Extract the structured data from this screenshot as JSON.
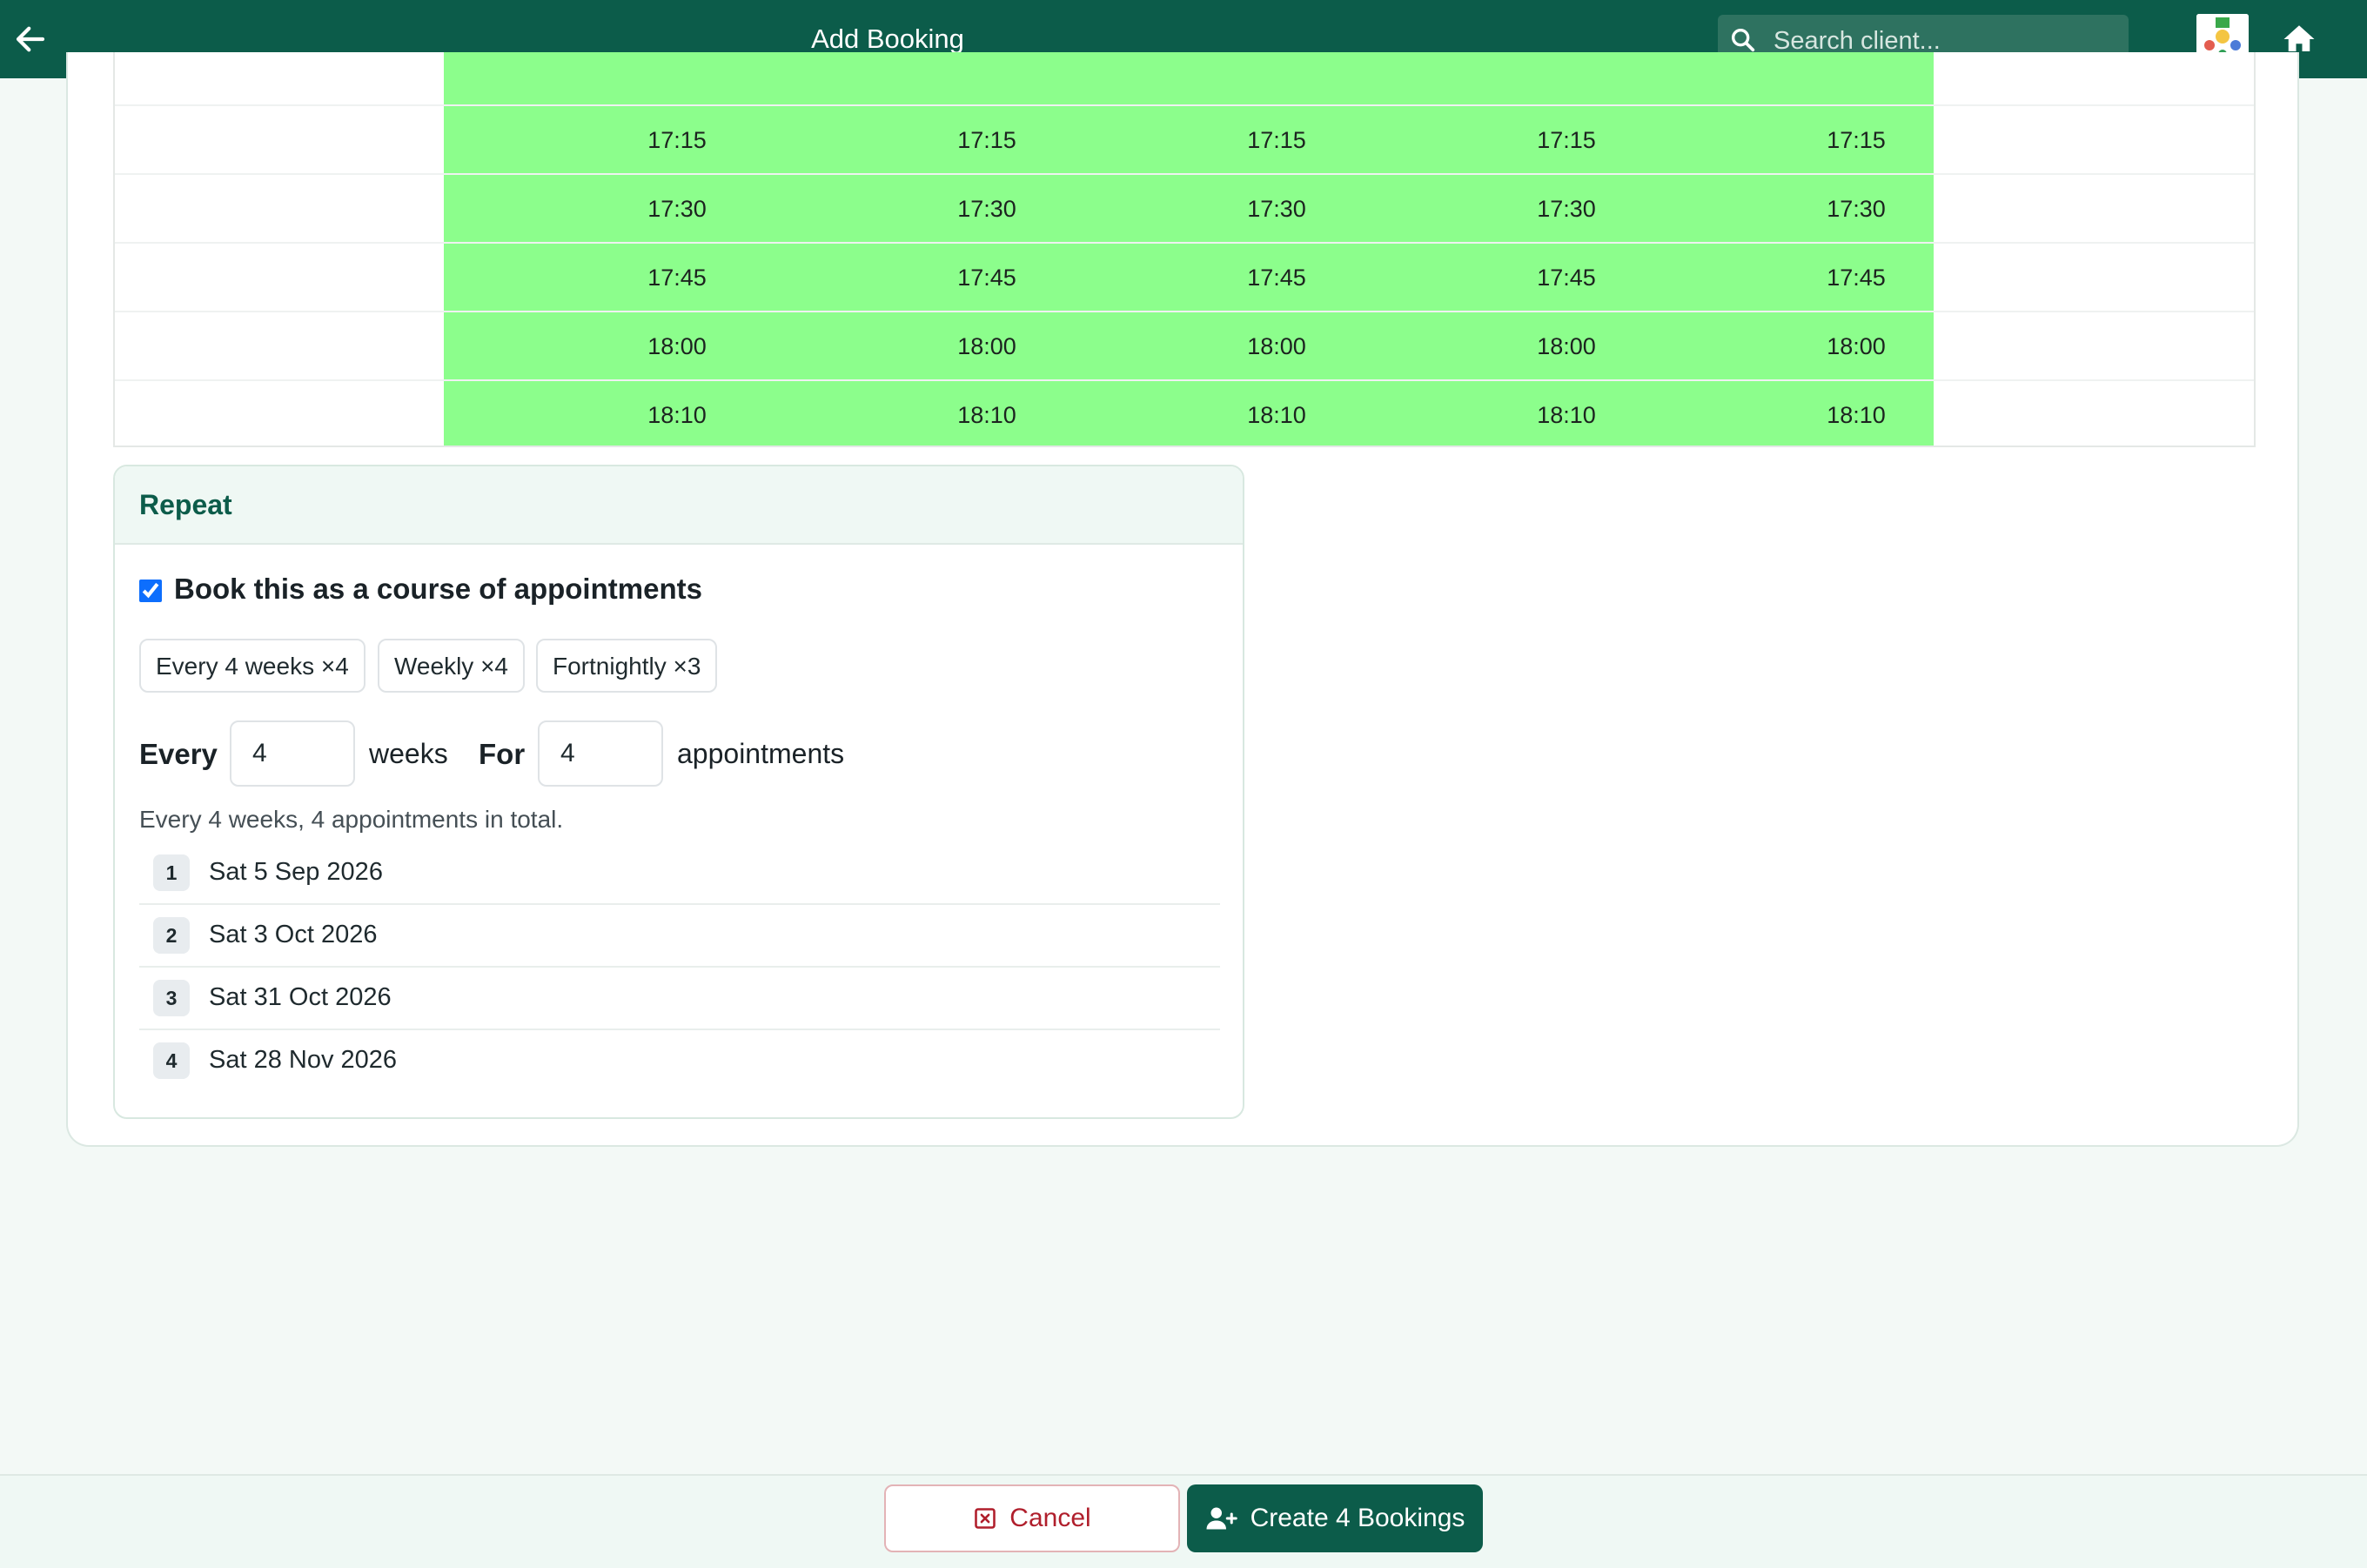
{
  "header": {
    "title": "Add Booking",
    "search_placeholder": "Search client...",
    "back_icon": "arrow-left-icon",
    "search_icon": "search-icon",
    "home_icon": "home-icon",
    "avatar_alt": "user-avatar"
  },
  "timeslots": {
    "times": [
      "17:15",
      "17:30",
      "17:45",
      "18:00",
      "18:10"
    ],
    "days": 5,
    "available_color": "#8cfe8c"
  },
  "repeat": {
    "heading": "Repeat",
    "course_checked": true,
    "course_label": "Book this as a course of appointments",
    "presets": [
      "Every 4 weeks ×4",
      "Weekly ×4",
      "Fortnightly ×3"
    ],
    "every_label": "Every",
    "every_value": "4",
    "weeks_label": "weeks",
    "for_label": "For",
    "for_value": "4",
    "appointments_label": "appointments",
    "summary": "Every 4 weeks, 4 appointments in total.",
    "dates": [
      {
        "num": "1",
        "date": "Sat 5 Sep 2026"
      },
      {
        "num": "2",
        "date": "Sat 3 Oct 2026"
      },
      {
        "num": "3",
        "date": "Sat 31 Oct 2026"
      },
      {
        "num": "4",
        "date": "Sat 28 Nov 2026"
      }
    ]
  },
  "footer": {
    "cancel_label": "Cancel",
    "create_label": "Create 4 Bookings",
    "cancel_icon": "x-square-icon",
    "create_icon": "person-plus-icon"
  },
  "colors": {
    "brand": "#0c5c4a",
    "danger": "#b01f2c",
    "checkbox": "#0d6efd"
  }
}
